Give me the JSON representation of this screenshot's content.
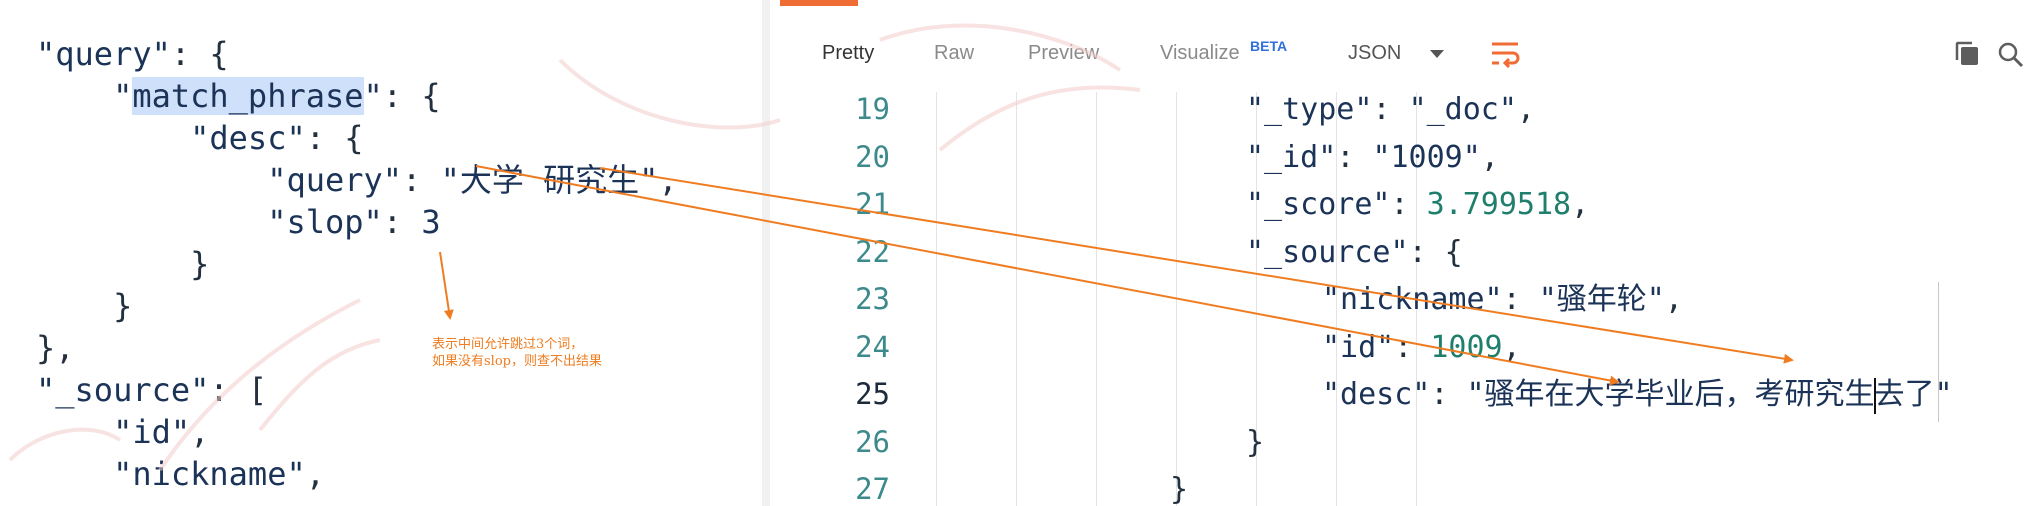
{
  "request_editor": {
    "lines": [
      {
        "parts": [
          {
            "t": "\"query\"",
            "c": "k-str"
          },
          {
            "t": ": {",
            "c": ""
          }
        ]
      },
      {
        "parts": [
          {
            "t": "    ",
            "c": ""
          },
          {
            "t": "\"",
            "c": "k-str"
          },
          {
            "t": "match_phrase",
            "c": "k-str k-hl"
          },
          {
            "t": "\"",
            "c": "k-str"
          },
          {
            "t": ": {",
            "c": ""
          }
        ]
      },
      {
        "parts": [
          {
            "t": "        ",
            "c": ""
          },
          {
            "t": "\"desc\"",
            "c": "k-str"
          },
          {
            "t": ": {",
            "c": ""
          }
        ]
      },
      {
        "parts": [
          {
            "t": "            ",
            "c": ""
          },
          {
            "t": "\"query\"",
            "c": "k-str"
          },
          {
            "t": ": ",
            "c": ""
          },
          {
            "t": "\"大学 研究生\"",
            "c": "k-str"
          },
          {
            "t": ",",
            "c": ""
          }
        ]
      },
      {
        "parts": [
          {
            "t": "            ",
            "c": ""
          },
          {
            "t": "\"slop\"",
            "c": "k-str"
          },
          {
            "t": ": ",
            "c": ""
          },
          {
            "t": "3",
            "c": "k-num"
          }
        ]
      },
      {
        "parts": [
          {
            "t": "        }",
            "c": ""
          }
        ]
      },
      {
        "parts": [
          {
            "t": "    }",
            "c": ""
          }
        ]
      },
      {
        "parts": [
          {
            "t": "},",
            "c": ""
          }
        ]
      },
      {
        "parts": [
          {
            "t": "\"_source\"",
            "c": "k-str"
          },
          {
            "t": ": [",
            "c": ""
          }
        ]
      },
      {
        "parts": [
          {
            "t": "    ",
            "c": ""
          },
          {
            "t": "\"id\"",
            "c": "k-str"
          },
          {
            "t": ",",
            "c": ""
          }
        ]
      },
      {
        "parts": [
          {
            "t": "    ",
            "c": ""
          },
          {
            "t": "\"nickname\"",
            "c": "k-str"
          },
          {
            "t": ",",
            "c": ""
          }
        ]
      }
    ],
    "annotation": "表示中间允许跳过3个词，\n如果没有slop，则查不出结果"
  },
  "response_toolbar": {
    "tabs": [
      "Pretty",
      "Raw",
      "Preview",
      "Visualize"
    ],
    "active_tab": "Pretty",
    "beta_badge": "BETA",
    "format": "JSON",
    "icons": [
      "chevron-down-icon",
      "wrap-lines-icon",
      "copy-icon",
      "search-icon"
    ],
    "accent_color": "#ef6c35"
  },
  "response_body": {
    "line_numbers": [
      "19",
      "20",
      "21",
      "22",
      "23",
      "24",
      "25",
      "26",
      "27"
    ],
    "current_line": "25",
    "lines": [
      {
        "parts": [
          {
            "t": "\"_type\"",
            "c": "r-str"
          },
          {
            "t": ": ",
            "c": ""
          },
          {
            "t": "\"_doc\"",
            "c": "r-str"
          },
          {
            "t": ",",
            "c": ""
          }
        ]
      },
      {
        "parts": [
          {
            "t": "\"_id\"",
            "c": "r-str"
          },
          {
            "t": ": ",
            "c": ""
          },
          {
            "t": "\"1009\"",
            "c": "r-str"
          },
          {
            "t": ",",
            "c": ""
          }
        ]
      },
      {
        "parts": [
          {
            "t": "\"_score\"",
            "c": "r-str"
          },
          {
            "t": ": ",
            "c": ""
          },
          {
            "t": "3.799518",
            "c": "r-num"
          },
          {
            "t": ",",
            "c": ""
          }
        ]
      },
      {
        "parts": [
          {
            "t": "\"_source\"",
            "c": "r-str"
          },
          {
            "t": ": {",
            "c": ""
          }
        ]
      },
      {
        "parts": [
          {
            "t": "\"nickname\"",
            "c": "r-str"
          },
          {
            "t": ": ",
            "c": ""
          },
          {
            "t": "\"骚年轮\"",
            "c": "r-str"
          },
          {
            "t": ",",
            "c": ""
          }
        ]
      },
      {
        "parts": [
          {
            "t": "\"id\"",
            "c": "r-str"
          },
          {
            "t": ": ",
            "c": ""
          },
          {
            "t": "1009",
            "c": "r-num"
          },
          {
            "t": ",",
            "c": ""
          }
        ]
      },
      {
        "parts": [
          {
            "t": "\"desc\"",
            "c": "r-str"
          },
          {
            "t": ": ",
            "c": ""
          },
          {
            "t": "\"骚年在大学毕业后，考研究生去了\"",
            "c": "r-str"
          }
        ]
      },
      {
        "parts": [
          {
            "t": "}",
            "c": ""
          }
        ]
      },
      {
        "parts": [
          {
            "t": "}",
            "c": ""
          }
        ]
      }
    ]
  },
  "annotation_color": "#ef7c20"
}
